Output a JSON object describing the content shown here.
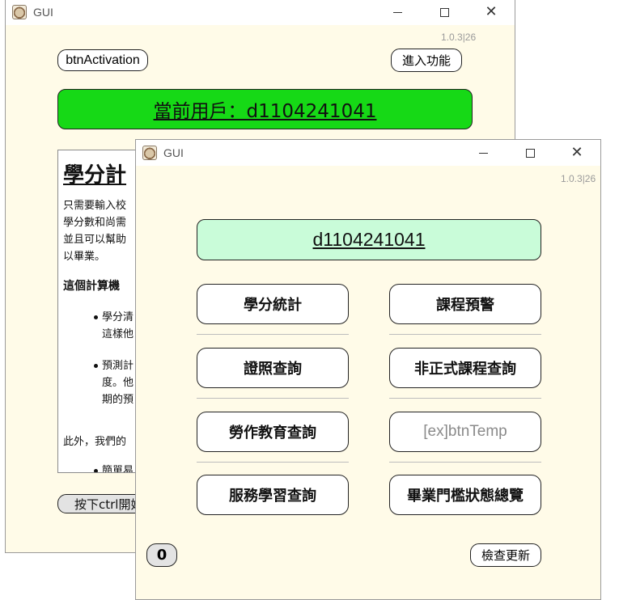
{
  "back_window": {
    "title": "GUI",
    "version": "1.0.3|26",
    "activation_button": "btnActivation",
    "enter_button": "進入功能",
    "current_user": "當前用戶：d1104241041",
    "intro": {
      "heading": "學分計",
      "paragraph_lines": [
        "只需要輸入校",
        "學分數和尚需",
        "並且可以幫助",
        "以畢業。"
      ],
      "subheading": "這個計算機",
      "bullet1_lines": [
        "學分清",
        "這樣他"
      ],
      "bullet2_lines": [
        "預測計",
        "度。他",
        "期的預"
      ],
      "footer_line": "此外，我們的",
      "bullet3_line": "簡單易"
    },
    "ctrl_hint_button": "按下ctrl開始"
  },
  "front_window": {
    "title": "GUI",
    "version": "1.0.3|26",
    "student_id": "d1104241041",
    "buttons": [
      {
        "label": "學分統計",
        "enabled": true
      },
      {
        "label": "課程預警",
        "enabled": true
      },
      {
        "label": "證照查詢",
        "enabled": true
      },
      {
        "label": "非正式課程查詢",
        "enabled": true
      },
      {
        "label": "勞作教育查詢",
        "enabled": true
      },
      {
        "label": "[ex]btnTemp",
        "enabled": false
      },
      {
        "label": "服務學習查詢",
        "enabled": true
      },
      {
        "label": "畢業門檻狀態總覽",
        "enabled": true
      }
    ],
    "counter": "0",
    "update_button": "檢查更新"
  },
  "colors": {
    "window_bg": "#fffbe8",
    "user_bar_green": "#16d916",
    "student_id_bg": "#c9fcd9"
  },
  "icons": {
    "app": "cat-icon",
    "minimize": "minimize-icon",
    "maximize": "maximize-icon",
    "close": "close-icon"
  }
}
